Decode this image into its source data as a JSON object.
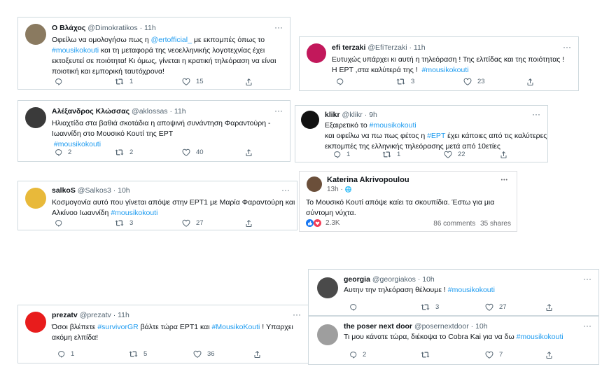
{
  "tweets": [
    {
      "name": "Ο Βλάχος",
      "handle": "@Dimokratikos",
      "time": "· 11h",
      "avatar_color": "#8a7a60",
      "lines": [
        [
          {
            "t": "Οφείλω να ομολογήσω πως η "
          },
          {
            "t": "@ertofficial_",
            "tag": true
          },
          {
            "t": " με εκπομπές όπως το"
          }
        ],
        [
          {
            "t": "#mousikokouti",
            "tag": true
          },
          {
            "t": " και τη μεταφορά της νεοελληνικής λογοτεχνίας έχει"
          }
        ],
        [
          {
            "t": "εκτοξευτεί σε ποιότητα! Κι όμως, γίνεται η κρατική τηλεόραση να είναι"
          }
        ],
        [
          {
            "t": "ποιοτική και εμπορική ταυτόχρονα!"
          }
        ]
      ],
      "replies": "",
      "retweets": "1",
      "likes": "15"
    },
    {
      "name": "efi terzaki",
      "handle": "@EfiTerzaki",
      "time": "· 11h",
      "avatar_color": "#c2185b",
      "lines": [
        [
          {
            "t": "Ευτυχώς υπάρχει κι αυτή η τηλεόραση ! Της ελπίδας και της ποιότητας !"
          }
        ],
        [
          {
            "t": "Η ΕΡΤ ,στα καλύτερά της !  "
          },
          {
            "t": "#mousikokouti",
            "tag": true
          }
        ]
      ],
      "replies": "",
      "retweets": "3",
      "likes": "23"
    },
    {
      "name": "Αλέξανδρος Κλώσσας",
      "handle": "@aklossas",
      "time": "· 11h",
      "avatar_color": "#3a3a3a",
      "lines": [
        [
          {
            "t": "Ηλιαχτίδα στα βαθιά σκοτάδια η αποψινή συνάντηση Φαραντούρη -"
          }
        ],
        [
          {
            "t": "Ιωαννίδη στο Μουσικό Κουτί της ΕΡΤ"
          }
        ],
        [
          {
            "t": " "
          },
          {
            "t": "#mousikokouti",
            "tag": true
          }
        ]
      ],
      "replies": "2",
      "retweets": "2",
      "likes": "40"
    },
    {
      "name": "klikr",
      "handle": "@klikr",
      "time": "· 9h",
      "avatar_color": "#111111",
      "lines": [
        [
          {
            "t": "Εξαιρετικό το "
          },
          {
            "t": "#mousikokouti",
            "tag": true
          }
        ],
        [
          {
            "t": "και οφείλω να πω πως φέτος η "
          },
          {
            "t": "#ΕΡΤ",
            "tag": true
          },
          {
            "t": " έχει κάποιες από τις καλύτερες"
          }
        ],
        [
          {
            "t": "εκπομπές της ελληνικής τηλεόρασης μετά από 10ετίες"
          }
        ]
      ],
      "replies": "1",
      "retweets": "1",
      "likes": "22"
    },
    {
      "name": "salkoS",
      "handle": "@Salkos3",
      "time": "· 10h",
      "avatar_color": "#e8b93a",
      "lines": [
        [
          {
            "t": "Κοσμογονία αυτό που γίνεται απόψε στην ΕΡΤ1 με Μαρία Φαραντούρη και"
          }
        ],
        [
          {
            "t": "Αλκίνοο Ιωαννίδη "
          },
          {
            "t": "#mousikokouti",
            "tag": true
          }
        ]
      ],
      "replies": "",
      "retweets": "3",
      "likes": "27"
    },
    {
      "name": "prezatv",
      "handle": "@prezatv",
      "time": "· 11h",
      "avatar_color": "#e81c1c",
      "lines": [
        [
          {
            "t": "Όσοι βλέπετε "
          },
          {
            "t": "#survivorGR",
            "tag": true
          },
          {
            "t": " βάλτε τώρα ΕΡΤ1 και "
          },
          {
            "t": "#MousikoKouti",
            "tag": true
          },
          {
            "t": " ! Υπαρχει"
          }
        ],
        [
          {
            "t": "ακόμη ελπίδα!"
          }
        ]
      ],
      "replies": "1",
      "retweets": "5",
      "likes": "36"
    },
    {
      "name": "georgia",
      "handle": "@georgiakos",
      "time": "· 10h",
      "avatar_color": "#4a4a4a",
      "lines": [
        [
          {
            "t": "Αυτην την τηλεόραση θέλουμε ! "
          },
          {
            "t": "#mousikokouti",
            "tag": true
          }
        ]
      ],
      "replies": "",
      "retweets": "3",
      "likes": "27"
    },
    {
      "name": "the poser next door",
      "handle": "@posernextdoor",
      "time": "· 10h",
      "avatar_color": "#9e9e9e",
      "lines": [
        [
          {
            "t": "Τι μου κάνατε τώρα, διέκοψα το Cobra Kai για να δω "
          },
          {
            "t": "#mousikokouti",
            "tag": true
          }
        ]
      ],
      "replies": "2",
      "retweets": "",
      "likes": "7"
    }
  ],
  "facebook": {
    "name": "Katerina Akrivopoulou",
    "time": "13h ·",
    "globe": "🌐",
    "text": [
      "Το Μουσικό Κουτί απόψε καίει τα σκουπίδια. Έστω για μια",
      "σύντομη νύχτα."
    ],
    "reactions": "2.3K",
    "comments": "86 comments",
    "shares": "35 shares",
    "dots": "•••"
  },
  "more_icon": "···",
  "colors": {
    "link": "#1d9bf0",
    "text": "#0f1419",
    "muted": "#536471",
    "border": "#cfd9de"
  }
}
